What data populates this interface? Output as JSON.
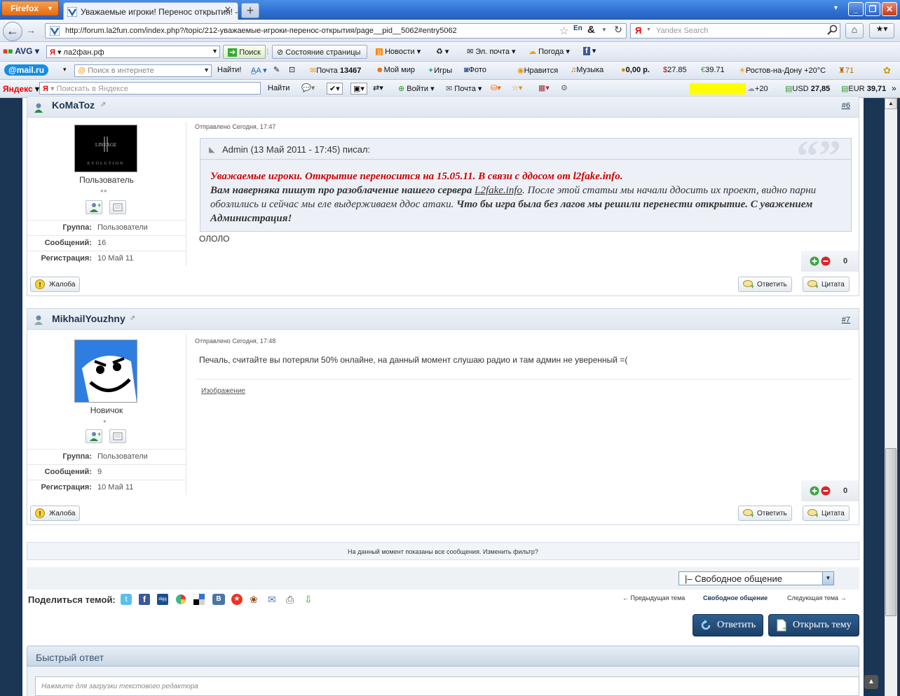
{
  "browser": {
    "app_button": "Firefox",
    "tab_title": "Уважаемые игроки! Перенос открытия! - ...",
    "url": "http://forum.la2fun.com/index.php?/topic/212-уважаемые-игроки-перенос-открытия/page__pid__5062#entry5062",
    "search_placeholder": "Yandex Search"
  },
  "avg_toolbar": {
    "logo": "AVG",
    "search_value": "ла2фан.рф",
    "search_button": "Поиск",
    "page_status": "Состояние страницы",
    "news": "Новости",
    "email": "Эл. почта",
    "weather": "Погода"
  },
  "mail_toolbar": {
    "logo": "@mail.ru",
    "search_placeholder": "Поиск в интернете",
    "find_button": "Найти!",
    "mail_label": "Почта",
    "mail_count": "13467",
    "my_world": "Мой мир",
    "games": "Игры",
    "photo": "Фото",
    "likes": "Нравится",
    "music": "Музыка",
    "balance": "0,00 р.",
    "usd": "27.85",
    "eur": "39.71",
    "weather": "Ростов-на-Дону +20°C",
    "points": "71"
  },
  "yandex_toolbar": {
    "logo": "Яндекс",
    "search_placeholder": "Поискать в Яндексе",
    "find_button": "Найти",
    "login": "Войти",
    "mail": "Почта",
    "temp": "+20",
    "usd_label": "USD",
    "usd_value": "27,85",
    "eur_label": "EUR",
    "eur_value": "39,71"
  },
  "posts": [
    {
      "author": "KoMaToz",
      "number": "#6",
      "role": "Пользователь",
      "posted": "Отправлено Сегодня, 17:47",
      "group_label": "Группа:",
      "group": "Пользователи",
      "messages_label": "Сообщений:",
      "messages": "16",
      "reg_label": "Регистрация:",
      "reg": "10 Май 11",
      "quote_header": "Admin (13 Май 2011 - 17:45) писал:",
      "quote_red": "Уважаемые игроки. Открытие переносится на 15.05.11. В связи с ддосом от l2fake.info.",
      "quote_bold1": "Вам наверняка пишут про разоблачение нашего сервера",
      "quote_link": "L2fake.info",
      "quote_italic": ". После этой статьи мы начали ддосить их проект, видно парни обозлились и сейчас мы еле выдерживаем ддос атаки.",
      "quote_bold2": "Что бы игра была без лагов мы решили перенести открытие. С уважением Администрация!",
      "body": "ОЛОЛО",
      "rep": "0",
      "report": "Жалоба",
      "reply": "Ответить",
      "quote_btn": "Цитата"
    },
    {
      "author": "MikhailYouzhny",
      "number": "#7",
      "role": "Новичок",
      "posted": "Отправлено Сегодня, 17:48",
      "group_label": "Группа:",
      "group": "Пользователи",
      "messages_label": "Сообщений:",
      "messages": "9",
      "reg_label": "Регистрация:",
      "reg": "10 Май 11",
      "body": "Печаль, считайте вы потеряли 50% онлайне, на данный момент слушаю радио и там админ не уверенный =(",
      "signature_link": "Изображение",
      "rep": "0",
      "report": "Жалоба",
      "reply": "Ответить",
      "quote_btn": "Цитата"
    }
  ],
  "filter_text": "На данный момент показаны все сообщения. Изменить фильтр?",
  "forum_select": "|– Свободное общение",
  "share_label": "Поделиться темой:",
  "prev_topic": "← Предыдущая тема",
  "current_forum": "Свободное общение",
  "next_topic": "Следующая тема →",
  "reply_button": "Ответить",
  "new_topic_button": "Открыть тему",
  "quick_reply_title": "Быстрый ответ",
  "editor_placeholder": "Нажмите для загрузки текстового редактора",
  "colors": {
    "accent": "#1d3652",
    "quote_red": "#cc0000",
    "button_dark": "#1d4068"
  }
}
